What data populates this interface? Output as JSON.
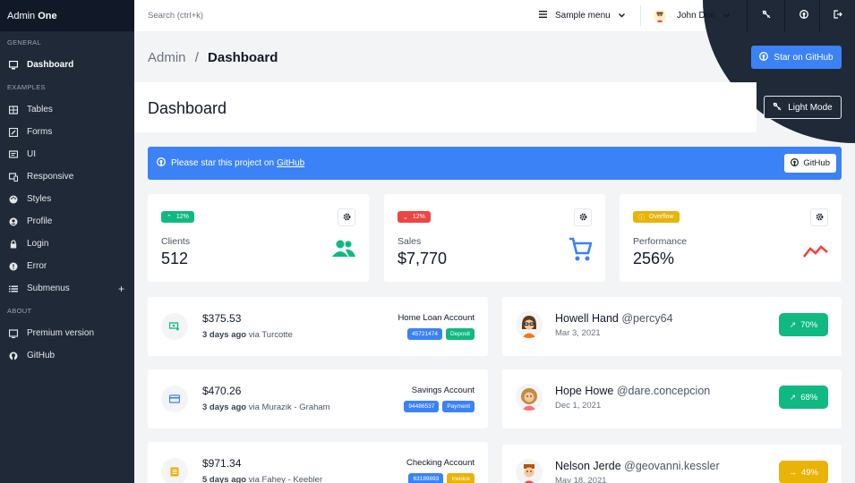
{
  "app": {
    "brand_prefix": "Admin",
    "brand_bold": "One"
  },
  "sidebar": {
    "sections": [
      {
        "label": "GENERAL"
      },
      {
        "label": "EXAMPLES"
      },
      {
        "label": "ABOUT"
      }
    ],
    "items": [
      {
        "label": "Dashboard",
        "icon": "monitor-icon",
        "active": true
      },
      {
        "label": "Tables",
        "icon": "table-icon"
      },
      {
        "label": "Forms",
        "icon": "edit-square-icon"
      },
      {
        "label": "UI",
        "icon": "tv-icon"
      },
      {
        "label": "Responsive",
        "icon": "responsive-icon"
      },
      {
        "label": "Styles",
        "icon": "palette-icon"
      },
      {
        "label": "Profile",
        "icon": "account-circle-icon"
      },
      {
        "label": "Login",
        "icon": "lock-icon"
      },
      {
        "label": "Error",
        "icon": "alert-circle-icon"
      },
      {
        "label": "Submenus",
        "icon": "list-icon",
        "expand": "+"
      },
      {
        "label": "Premium version",
        "icon": "credit-card-outline-icon"
      },
      {
        "label": "GitHub",
        "icon": "github-icon"
      }
    ]
  },
  "topbar": {
    "search_placeholder": "Search (ctrl+k)",
    "sample_menu": "Sample menu",
    "user_name": "John Doe"
  },
  "breadcrumb": {
    "root": "Admin",
    "sep": "/",
    "current": "Dashboard"
  },
  "buttons": {
    "star_github": "Star on GitHub",
    "light_mode": "Light Mode"
  },
  "page_title": "Dashboard",
  "notice": {
    "text": "Please star this project on",
    "link": "GitHub",
    "button": "GitHub"
  },
  "widgets": [
    {
      "trend": "12%",
      "trend_color": "#10b981",
      "label": "Clients",
      "value": "512",
      "icon": "account-multiple-icon",
      "icon_color": "#10b981"
    },
    {
      "trend": "12%",
      "trend_color": "#ef4444",
      "label": "Sales",
      "value": "$7,770",
      "icon": "cart-icon",
      "icon_color": "#3b82f6"
    },
    {
      "trend": "Overflow",
      "trend_color": "#eab308",
      "label": "Performance",
      "value": "256%",
      "icon": "chart-line-icon",
      "icon_color": "#ef4444"
    }
  ],
  "transactions": [
    {
      "amount": "$375.53",
      "when": "3 days ago",
      "via": "via Turcotte",
      "account": "Home Loan Account",
      "number": "45721474",
      "type": "Deposit",
      "type_color": "#10b981",
      "icon": "cash-plus-icon",
      "icon_color": "#10b981"
    },
    {
      "amount": "$470.26",
      "when": "3 days ago",
      "via": "via Murazik - Graham",
      "account": "Savings Account",
      "number": "94486537",
      "type": "Payment",
      "type_color": "#3b82f6",
      "icon": "credit-card-icon",
      "icon_color": "#3b82f6"
    },
    {
      "amount": "$971.34",
      "when": "5 days ago",
      "via": "via Fahey - Keebler",
      "account": "Checking Account",
      "number": "63189893",
      "type": "Invoice",
      "type_color": "#eab308",
      "icon": "receipt-icon",
      "icon_color": "#eab308"
    }
  ],
  "clients": [
    {
      "name": "Howell Hand",
      "handle": "@percy64",
      "date": "Mar 3, 2021",
      "progress": "70%",
      "pill_color": "#10b981"
    },
    {
      "name": "Hope Howe",
      "handle": "@dare.concepcion",
      "date": "Dec 1, 2021",
      "progress": "68%",
      "pill_color": "#10b981"
    },
    {
      "name": "Nelson Jerde",
      "handle": "@geovanni.kessler",
      "date": "May 18, 2021",
      "progress": "49%",
      "pill_color": "#eab308"
    }
  ]
}
